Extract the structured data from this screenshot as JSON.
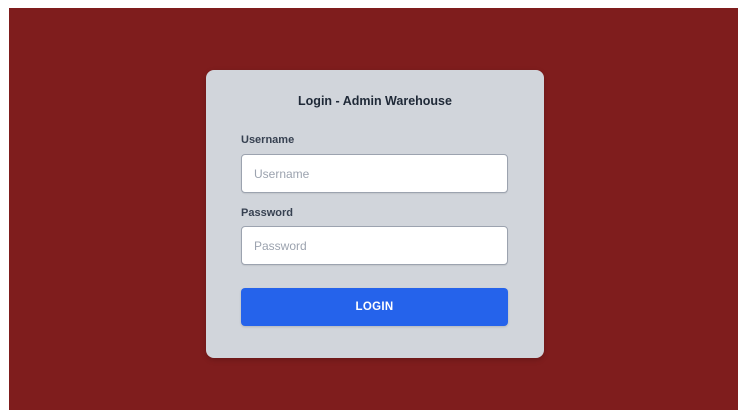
{
  "colors": {
    "background": "#7f1d1d",
    "card": "#d1d5db",
    "button": "#2563eb"
  },
  "login_form": {
    "title": "Login - Admin Warehouse",
    "username_label": "Username",
    "username_placeholder": "Username",
    "username_value": "",
    "password_label": "Password",
    "password_placeholder": "Password",
    "password_value": "",
    "submit_label": "LOGIN"
  }
}
